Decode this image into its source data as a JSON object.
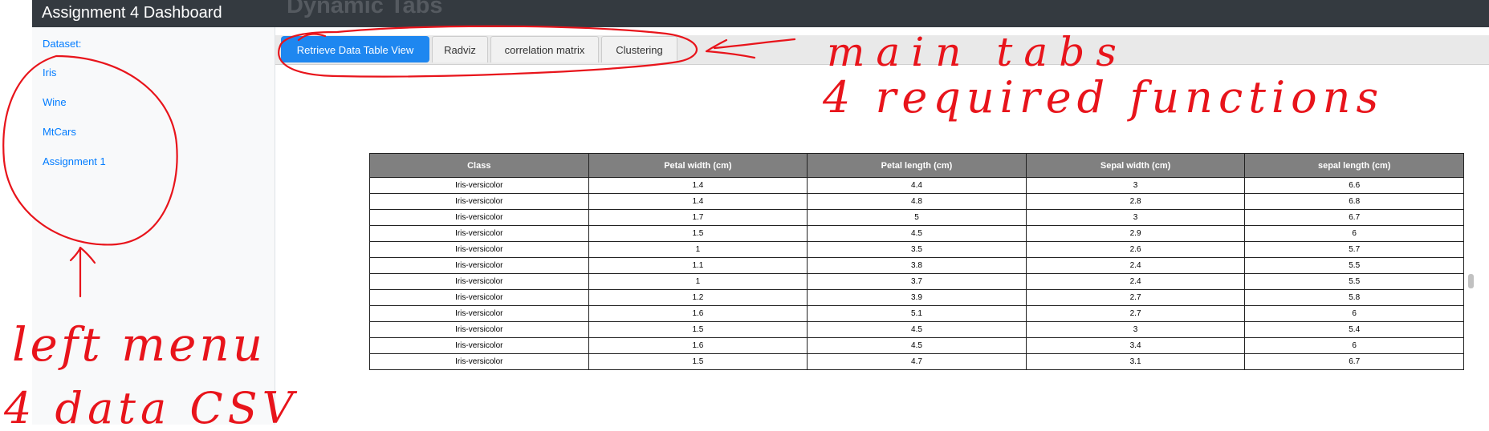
{
  "header": {
    "title": "Assignment 4 Dashboard",
    "page_heading": "Dynamic Tabs"
  },
  "sidebar": {
    "heading": "Dataset:",
    "items": [
      {
        "label": "Iris"
      },
      {
        "label": "Wine"
      },
      {
        "label": "MtCars"
      },
      {
        "label": "Assignment 1"
      }
    ]
  },
  "tabs": [
    {
      "label": "Retrieve Data Table View",
      "active": true
    },
    {
      "label": "Radviz",
      "active": false
    },
    {
      "label": "correlation matrix",
      "active": false
    },
    {
      "label": "Clustering",
      "active": false
    }
  ],
  "table": {
    "columns": [
      "Class",
      "Petal width (cm)",
      "Petal length (cm)",
      "Sepal width (cm)",
      "sepal length (cm)"
    ],
    "rows": [
      [
        "Iris-versicolor",
        "1.4",
        "4.4",
        "3",
        "6.6"
      ],
      [
        "Iris-versicolor",
        "1.4",
        "4.8",
        "2.8",
        "6.8"
      ],
      [
        "Iris-versicolor",
        "1.7",
        "5",
        "3",
        "6.7"
      ],
      [
        "Iris-versicolor",
        "1.5",
        "4.5",
        "2.9",
        "6"
      ],
      [
        "Iris-versicolor",
        "1",
        "3.5",
        "2.6",
        "5.7"
      ],
      [
        "Iris-versicolor",
        "1.1",
        "3.8",
        "2.4",
        "5.5"
      ],
      [
        "Iris-versicolor",
        "1",
        "3.7",
        "2.4",
        "5.5"
      ],
      [
        "Iris-versicolor",
        "1.2",
        "3.9",
        "2.7",
        "5.8"
      ],
      [
        "Iris-versicolor",
        "1.6",
        "5.1",
        "2.7",
        "6"
      ],
      [
        "Iris-versicolor",
        "1.5",
        "4.5",
        "3",
        "5.4"
      ],
      [
        "Iris-versicolor",
        "1.6",
        "4.5",
        "3.4",
        "6"
      ],
      [
        "Iris-versicolor",
        "1.5",
        "4.7",
        "3.1",
        "6.7"
      ]
    ]
  },
  "annotations": {
    "color": "#e8141b",
    "notes": [
      "main tabs",
      "4 required functions",
      "left menu",
      "4 data CSV"
    ]
  },
  "colors": {
    "topbar": "#343a40",
    "link": "#007bff",
    "active_tab": "#1e87f0",
    "table_header": "#808080"
  }
}
